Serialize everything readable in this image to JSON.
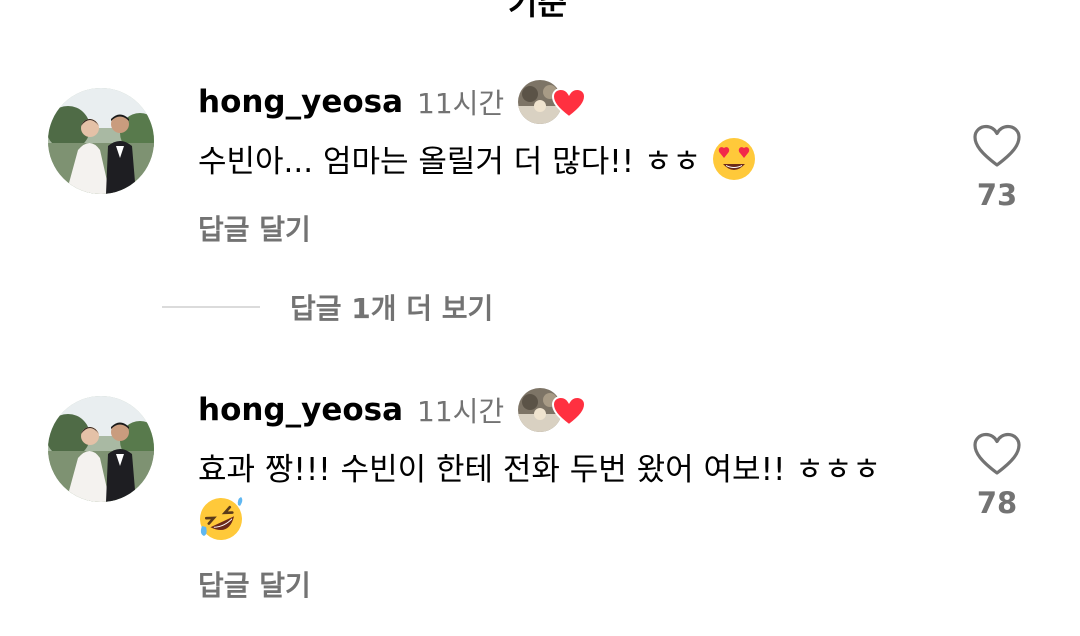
{
  "cutoff_text": "기준",
  "comments": [
    {
      "username": "hong_yeosa",
      "time": "11시간",
      "text": "수빈아... 엄마는 올릴거 더 많다!! ㅎㅎ",
      "emoji": "heart-eyes-emoji",
      "reply_label": "답글 달기",
      "like_count": "73"
    },
    {
      "username": "hong_yeosa",
      "time": "11시간",
      "text": "효과 짱!!! 수빈이 한테 전화 두번 왔어 여보!! ㅎㅎㅎ",
      "emoji": "rolling-laughing-emoji",
      "reply_label": "답글 달기",
      "like_count": "78"
    }
  ],
  "view_replies_label": "답글 1개 더 보기",
  "colors": {
    "secondary_text": "#737373",
    "divider": "#dbdbdb",
    "heart_red": "#ff3040"
  }
}
